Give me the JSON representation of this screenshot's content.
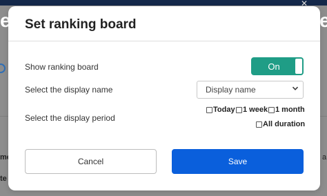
{
  "background": {
    "title_fragment_left": "e",
    "title_fragment_right": "e",
    "close_glyph": "✕",
    "text_left_1": "me",
    "text_left_2": "te",
    "text_right": "a"
  },
  "dialog": {
    "title": "Set ranking board",
    "show_ranking": {
      "label": "Show ranking board",
      "toggle_state": "On",
      "accent_color": "#1f9d86"
    },
    "display_name": {
      "label": "Select the display name",
      "selected": "Display name",
      "caret_icon": "chevron-down-icon"
    },
    "display_period": {
      "label": "Select the display period",
      "options": [
        {
          "label": "Today",
          "checked": false
        },
        {
          "label": "1 week",
          "checked": false
        },
        {
          "label": "1 month",
          "checked": false
        },
        {
          "label": "All duration",
          "checked": false
        }
      ]
    },
    "buttons": {
      "cancel": "Cancel",
      "save": "Save",
      "save_color": "#0a5fdc"
    }
  }
}
